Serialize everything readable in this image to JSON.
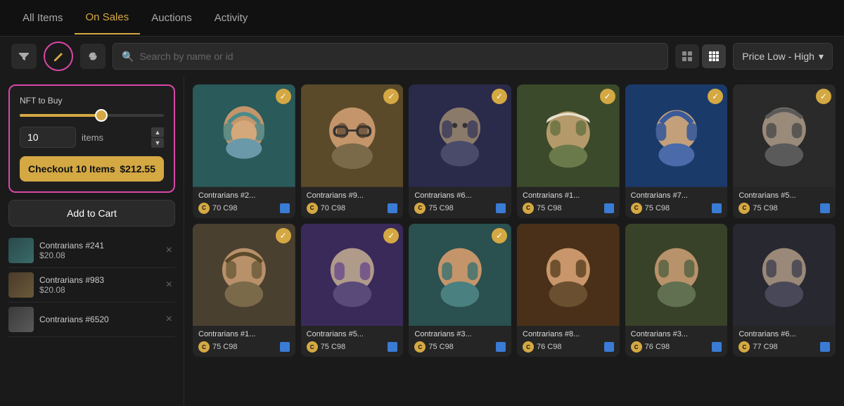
{
  "nav": {
    "tabs": [
      {
        "id": "all-items",
        "label": "All Items",
        "active": false
      },
      {
        "id": "on-sales",
        "label": "On Sales",
        "active": true
      },
      {
        "id": "auctions",
        "label": "Auctions",
        "active": false
      },
      {
        "id": "activity",
        "label": "Activity",
        "active": false
      }
    ]
  },
  "toolbar": {
    "search_placeholder": "Search by name or id",
    "sort_label": "Price Low - High"
  },
  "sidebar": {
    "nft_buy_label": "NFT to Buy",
    "quantity": "10",
    "quantity_unit": "items",
    "checkout_label": "Checkout 10 Items",
    "checkout_price": "$212.55",
    "add_to_cart_label": "Add to Cart",
    "cart_items": [
      {
        "name": "Contrarians #241",
        "price": "$20.08"
      },
      {
        "name": "Contrarians #983",
        "price": "$20.08"
      },
      {
        "name": "Contrarians #6520",
        "price": ""
      }
    ]
  },
  "nfts": [
    {
      "name": "Contrarians #2...",
      "price": "70 C98",
      "selected": true,
      "bg": "bg-teal",
      "row": 1
    },
    {
      "name": "Contrarians #9...",
      "price": "70 C98",
      "selected": true,
      "bg": "bg-brown",
      "row": 1
    },
    {
      "name": "Contrarians #6...",
      "price": "75 C98",
      "selected": true,
      "bg": "bg-dark",
      "row": 1
    },
    {
      "name": "Contrarians #1...",
      "price": "75 C98",
      "selected": true,
      "bg": "bg-olive",
      "row": 1
    },
    {
      "name": "Contrarians #7...",
      "price": "75 C98",
      "selected": true,
      "bg": "bg-blue",
      "row": 1
    },
    {
      "name": "Contrarians #5...",
      "price": "75 C98",
      "selected": true,
      "bg": "bg-gray",
      "row": 1
    },
    {
      "name": "Contrarians #1...",
      "price": "75 C98",
      "selected": true,
      "bg": "bg-muted",
      "row": 2
    },
    {
      "name": "Contrarians #5...",
      "price": "75 C98",
      "selected": true,
      "bg": "bg-purple",
      "row": 2
    },
    {
      "name": "Contrarians #3...",
      "price": "75 C98",
      "selected": true,
      "bg": "bg-teal",
      "row": 2
    },
    {
      "name": "Contrarians #8...",
      "price": "76 C98",
      "selected": false,
      "bg": "bg-brown",
      "row": 2
    },
    {
      "name": "Contrarians #3...",
      "price": "76 C98",
      "selected": false,
      "bg": "bg-olive",
      "row": 2
    },
    {
      "name": "Contrarians #6...",
      "price": "77 C98",
      "selected": false,
      "bg": "bg-dark",
      "row": 2
    }
  ],
  "icons": {
    "filter": "⚙",
    "eraser": "✏",
    "refresh": "↻",
    "search": "🔍",
    "grid_large": "⊞",
    "grid_small": "⊟",
    "chevron_down": "▾",
    "check": "✓",
    "close": "×",
    "up": "▲",
    "down": "▼"
  }
}
